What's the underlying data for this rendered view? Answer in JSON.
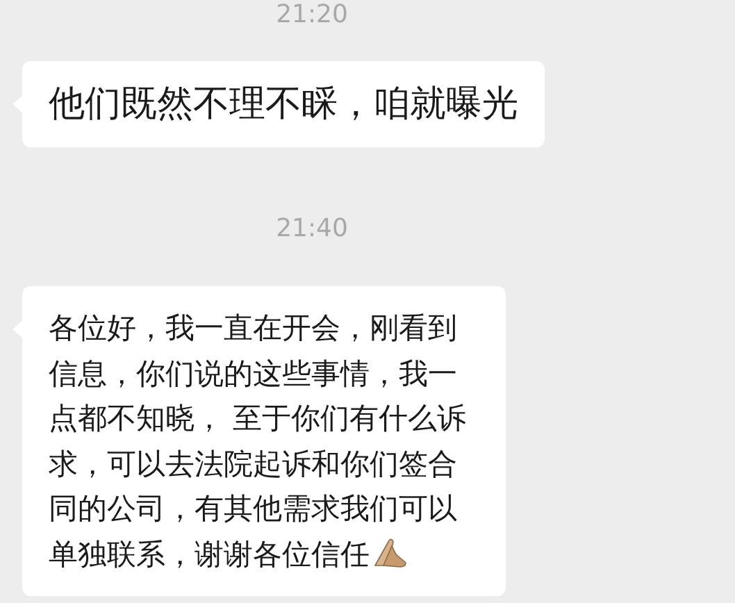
{
  "messages": [
    {
      "kind": "time",
      "text": "21:20"
    },
    {
      "kind": "bubble",
      "text": "他们既然不理不睬，咱就曝光"
    },
    {
      "kind": "time",
      "text": "21:40"
    },
    {
      "kind": "bubble",
      "text": "各位好，我一直在开会，刚看到信息，你们说的这些事情，我一点都不知晓， 至于你们有什么诉求，可以去法院起诉和你们签合同的公司，有其他需求我们可以单独联系，谢谢各位信任",
      "trailing_icon": true
    }
  ]
}
